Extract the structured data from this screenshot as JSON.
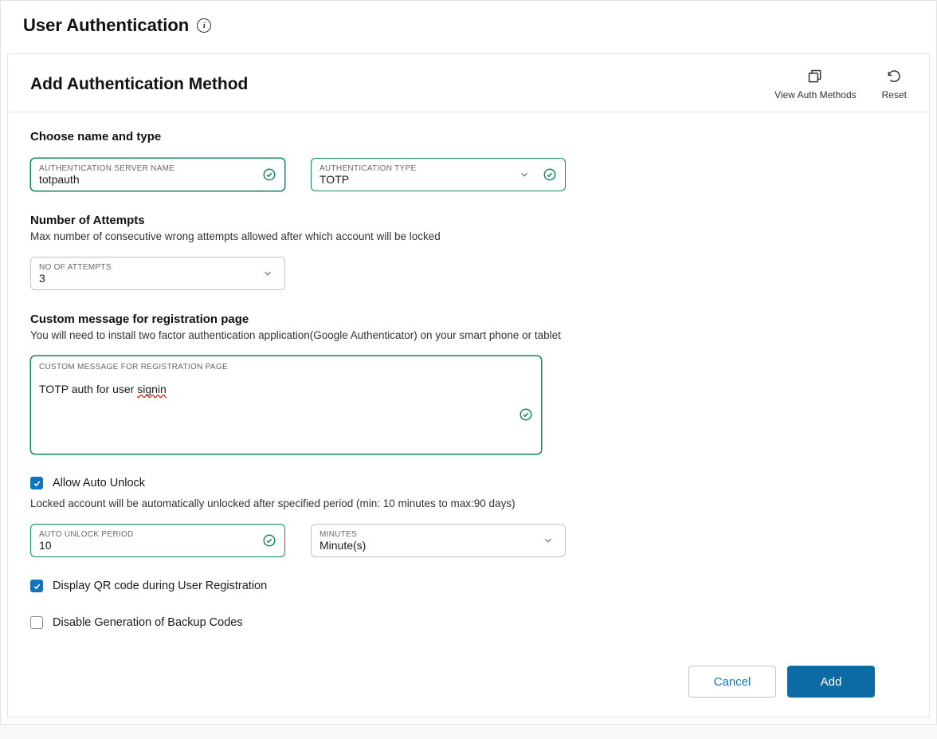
{
  "page": {
    "title": "User Authentication"
  },
  "panel": {
    "title": "Add Authentication Method",
    "actions": {
      "view_methods": "View Auth Methods",
      "reset": "Reset"
    }
  },
  "sections": {
    "name_type": {
      "title": "Choose name and type",
      "server_name_label": "AUTHENTICATION SERVER NAME",
      "server_name_value": "totpauth",
      "auth_type_label": "AUTHENTICATION TYPE",
      "auth_type_value": "TOTP"
    },
    "attempts": {
      "title": "Number of Attempts",
      "subtitle": "Max number of consecutive wrong attempts allowed after which account will be locked",
      "field_label": "NO OF ATTEMPTS",
      "field_value": "3"
    },
    "custom_msg": {
      "title": "Custom message for registration page",
      "subtitle": "You will need to install two factor authentication application(Google Authenticator) on your smart phone or tablet",
      "field_label": "CUSTOM MESSAGE FOR REGISTRATION PAGE",
      "field_value_pre": "TOTP auth for user ",
      "field_value_err": "signin"
    },
    "auto_unlock": {
      "checkbox_label": "Allow Auto Unlock",
      "subtitle": "Locked account will be automatically unlocked after specified period (min: 10 minutes to max:90 days)",
      "period_label": "AUTO UNLOCK PERIOD",
      "period_value": "10",
      "unit_label": "MINUTES",
      "unit_value": "Minute(s)"
    },
    "qr": {
      "label": "Display QR code during User Registration"
    },
    "backup": {
      "label": "Disable Generation of Backup Codes"
    }
  },
  "footer": {
    "cancel": "Cancel",
    "add": "Add"
  }
}
